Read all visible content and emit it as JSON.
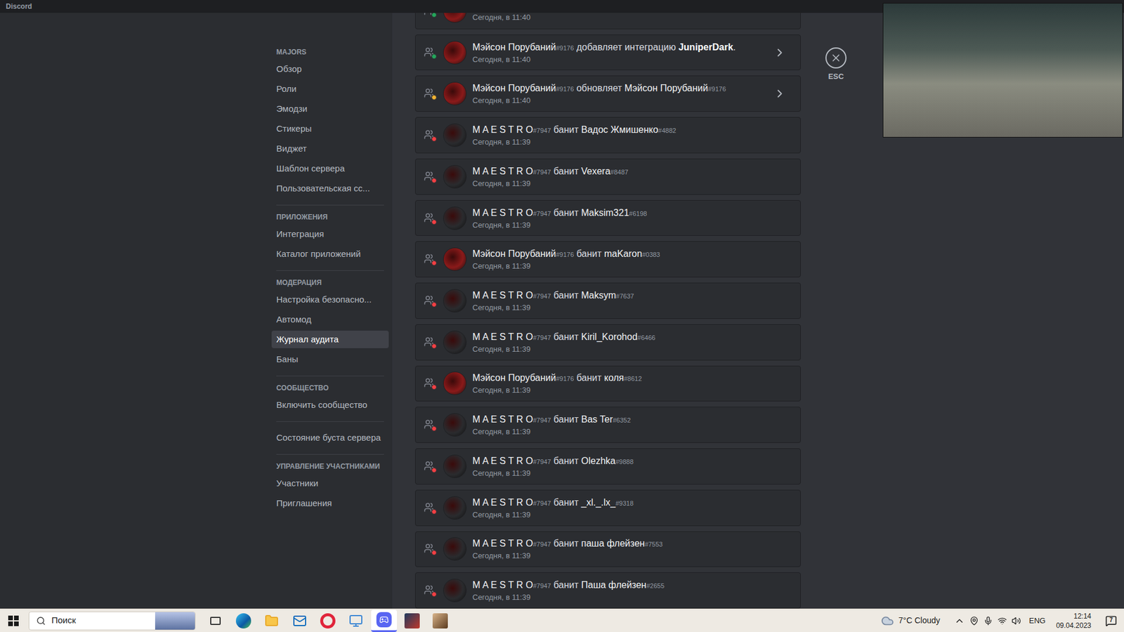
{
  "window": {
    "title": "Discord"
  },
  "sidebar": {
    "sections": [
      {
        "header": "MAJORS",
        "items": [
          {
            "label": "Обзор",
            "selected": false
          },
          {
            "label": "Роли",
            "selected": false
          },
          {
            "label": "Эмодзи",
            "selected": false
          },
          {
            "label": "Стикеры",
            "selected": false
          },
          {
            "label": "Виджет",
            "selected": false
          },
          {
            "label": "Шаблон сервера",
            "selected": false
          },
          {
            "label": "Пользовательская сс...",
            "selected": false
          }
        ]
      },
      {
        "header": "ПРИЛОЖЕНИЯ",
        "items": [
          {
            "label": "Интеграция",
            "selected": false
          },
          {
            "label": "Каталог приложений",
            "selected": false
          }
        ]
      },
      {
        "header": "МОДЕРАЦИЯ",
        "items": [
          {
            "label": "Настройка безопасно...",
            "selected": false
          },
          {
            "label": "Автомод",
            "selected": false
          },
          {
            "label": "Журнал аудита",
            "selected": true
          },
          {
            "label": "Баны",
            "selected": false
          }
        ]
      },
      {
        "header": "СООБЩЕСТВО",
        "items": [
          {
            "label": "Включить сообщество",
            "selected": false
          }
        ]
      },
      {
        "header": "",
        "items": [
          {
            "label": "Состояние буста сервера",
            "selected": false
          }
        ]
      },
      {
        "header": "УПРАВЛЕНИЕ УЧАСТНИКАМИ",
        "items": [
          {
            "label": "Участники",
            "selected": false
          },
          {
            "label": "Приглашения",
            "selected": false
          }
        ]
      }
    ]
  },
  "close_button": {
    "label": "ESC"
  },
  "audit_log": {
    "partial_entry": {
      "time": "Сегодня, в 11:40",
      "kind": "integration",
      "avatar_color": "#8b1a1a"
    },
    "entries": [
      {
        "actor": "Мэйсон Порубаний",
        "actor_tag": "#9176",
        "action": "добавляет интеграцию",
        "target": "JuniperDark",
        "target_tag": "",
        "suffix": ".",
        "time": "Сегодня, в 11:40",
        "kind": "integration",
        "expandable": true,
        "avatar_color": "#8b1a1a"
      },
      {
        "actor": "Мэйсон Порубаний",
        "actor_tag": "#9176",
        "action": "обновляет",
        "target": "Мэйсон Порубаний",
        "target_tag": "#9176",
        "suffix": "",
        "time": "Сегодня, в 11:40",
        "kind": "update",
        "expandable": true,
        "avatar_color": "#8b1a1a"
      },
      {
        "actor": "M A E S T R O",
        "actor_tag": "#7947",
        "action": "банит",
        "target": "Вадос Жмишенко",
        "target_tag": "#4882",
        "suffix": "",
        "time": "Сегодня, в 11:39",
        "kind": "ban",
        "expandable": false,
        "avatar_color": "#2a2b2e"
      },
      {
        "actor": "M A E S T R O",
        "actor_tag": "#7947",
        "action": "банит",
        "target": "Vexera",
        "target_tag": "#8487",
        "suffix": "",
        "time": "Сегодня, в 11:39",
        "kind": "ban",
        "expandable": false,
        "avatar_color": "#2a2b2e"
      },
      {
        "actor": "M A E S T R O",
        "actor_tag": "#7947",
        "action": "банит",
        "target": "Maksim321",
        "target_tag": "#6198",
        "suffix": "",
        "time": "Сегодня, в 11:39",
        "kind": "ban",
        "expandable": false,
        "avatar_color": "#2a2b2e"
      },
      {
        "actor": "Мэйсон Порубаний",
        "actor_tag": "#9176",
        "action": "банит",
        "target": "maKaron",
        "target_tag": "#0383",
        "suffix": "",
        "time": "Сегодня, в 11:39",
        "kind": "ban",
        "expandable": false,
        "avatar_color": "#8b1a1a"
      },
      {
        "actor": "M A E S T R O",
        "actor_tag": "#7947",
        "action": "банит",
        "target": "Maksym",
        "target_tag": "#7637",
        "suffix": "",
        "time": "Сегодня, в 11:39",
        "kind": "ban",
        "expandable": false,
        "avatar_color": "#2a2b2e"
      },
      {
        "actor": "M A E S T R O",
        "actor_tag": "#7947",
        "action": "банит",
        "target": "Kiril_Korohod",
        "target_tag": "#6466",
        "suffix": "",
        "time": "Сегодня, в 11:39",
        "kind": "ban",
        "expandable": false,
        "avatar_color": "#2a2b2e"
      },
      {
        "actor": "Мэйсон Порубаний",
        "actor_tag": "#9176",
        "action": "банит",
        "target": "коля",
        "target_tag": "#8612",
        "suffix": "",
        "time": "Сегодня, в 11:39",
        "kind": "ban",
        "expandable": false,
        "avatar_color": "#8b1a1a"
      },
      {
        "actor": "M A E S T R O",
        "actor_tag": "#7947",
        "action": "банит",
        "target": "Bas Ter",
        "target_tag": "#6352",
        "suffix": "",
        "time": "Сегодня, в 11:39",
        "kind": "ban",
        "expandable": false,
        "avatar_color": "#2a2b2e"
      },
      {
        "actor": "M A E S T R O",
        "actor_tag": "#7947",
        "action": "банит",
        "target": "Olezhka",
        "target_tag": "#9888",
        "suffix": "",
        "time": "Сегодня, в 11:39",
        "kind": "ban",
        "expandable": false,
        "avatar_color": "#2a2b2e"
      },
      {
        "actor": "M A E S T R O",
        "actor_tag": "#7947",
        "action": "банит",
        "target": "_xl._.lx_",
        "target_tag": "#9318",
        "suffix": "",
        "time": "Сегодня, в 11:39",
        "kind": "ban",
        "expandable": false,
        "avatar_color": "#2a2b2e"
      },
      {
        "actor": "M A E S T R O",
        "actor_tag": "#7947",
        "action": "банит",
        "target": "паша флейзен",
        "target_tag": "#7553",
        "suffix": "",
        "time": "Сегодня, в 11:39",
        "kind": "ban",
        "expandable": false,
        "avatar_color": "#2a2b2e"
      },
      {
        "actor": "M A E S T R O",
        "actor_tag": "#7947",
        "action": "банит",
        "target": "Паша флейзен",
        "target_tag": "#2655",
        "suffix": "",
        "time": "Сегодня, в 11:39",
        "kind": "ban",
        "expandable": false,
        "avatar_color": "#2a2b2e"
      }
    ]
  },
  "taskbar": {
    "search_placeholder": "Поиск",
    "apps": [
      {
        "selected": false
      },
      {
        "selected": false
      },
      {
        "selected": false
      },
      {
        "selected": false
      },
      {
        "selected": false
      },
      {
        "selected": false
      },
      {
        "selected": true
      },
      {
        "selected": false
      },
      {
        "selected": false
      }
    ],
    "weather": "7°C Cloudy",
    "language": "ENG",
    "time": "12:14",
    "date": "09.04.2023",
    "notifications": "7"
  }
}
